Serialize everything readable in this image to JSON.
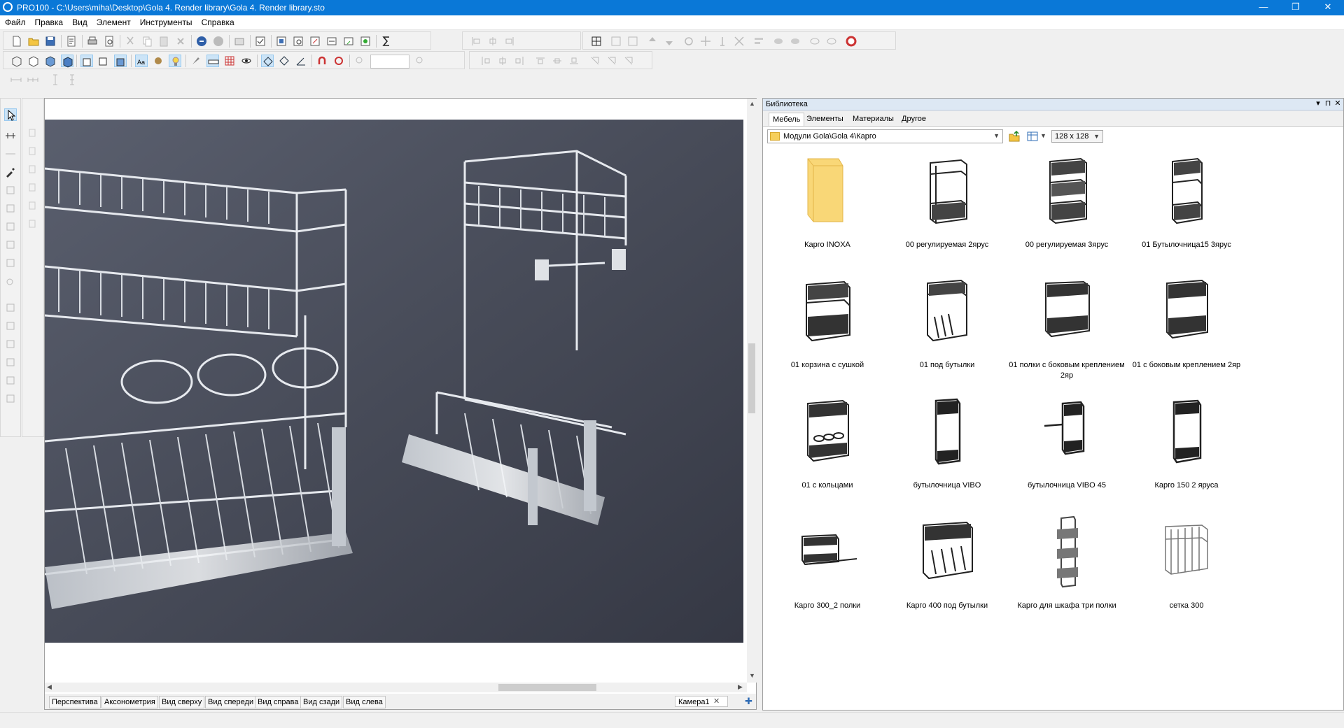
{
  "window": {
    "title": "PRO100 - C:\\Users\\miha\\Desktop\\Gola 4. Render library\\Gola 4. Render library.sto",
    "minimize": "—",
    "maximize": "❐",
    "close": "✕"
  },
  "menu": [
    "Файл",
    "Правка",
    "Вид",
    "Элемент",
    "Инструменты",
    "Справка"
  ],
  "view_tabs": [
    "Перспектива",
    "Аксонометрия",
    "Вид сверху",
    "Вид спереди",
    "Вид справа",
    "Вид сзади",
    "Вид слева"
  ],
  "camera": {
    "label": "Камера1",
    "close": "✕",
    "add": "✚"
  },
  "library": {
    "title": "Библиотека",
    "tabs": [
      "Мебель",
      "Элементы",
      "Материалы",
      "Другое"
    ],
    "active_tab": "Мебель",
    "path": "Модули Gola\\Gola 4\\Карго",
    "thumb_size": "128 x 128",
    "items": [
      {
        "label": "Карго INOXA",
        "icon": "folder-icon"
      },
      {
        "label": "00 регулируемая 2ярус",
        "icon": "cargo-2tier-icon"
      },
      {
        "label": "00 регулируемая 3ярус",
        "icon": "cargo-3tier-icon"
      },
      {
        "label": "01 Бутылочница15 3ярус",
        "icon": "bottle-rack-icon"
      },
      {
        "label": "01 корзина с сушкой",
        "icon": "basket-dryer-icon"
      },
      {
        "label": "01 под бутылки",
        "icon": "bottle-basket-icon"
      },
      {
        "label": "01 полки с боковым креплением 2яр",
        "icon": "side-mount-shelves-icon"
      },
      {
        "label": "01 с боковым креплением 2яр",
        "icon": "side-mount-icon"
      },
      {
        "label": "01 с кольцами",
        "icon": "rings-basket-icon"
      },
      {
        "label": "бутылочница VIBO",
        "icon": "vibo-rack-icon"
      },
      {
        "label": "бутылочница VIBO 45",
        "icon": "vibo45-rack-icon"
      },
      {
        "label": "Карго 150 2 яруса",
        "icon": "cargo150-icon"
      },
      {
        "label": "Карго 300_2 полки",
        "icon": "cargo300-icon"
      },
      {
        "label": "Карго 400 под бутылки",
        "icon": "cargo400-icon"
      },
      {
        "label": "Карго для шкафа три полки",
        "icon": "tall-cargo-icon"
      },
      {
        "label": "сетка 300",
        "icon": "mesh300-icon"
      }
    ]
  }
}
